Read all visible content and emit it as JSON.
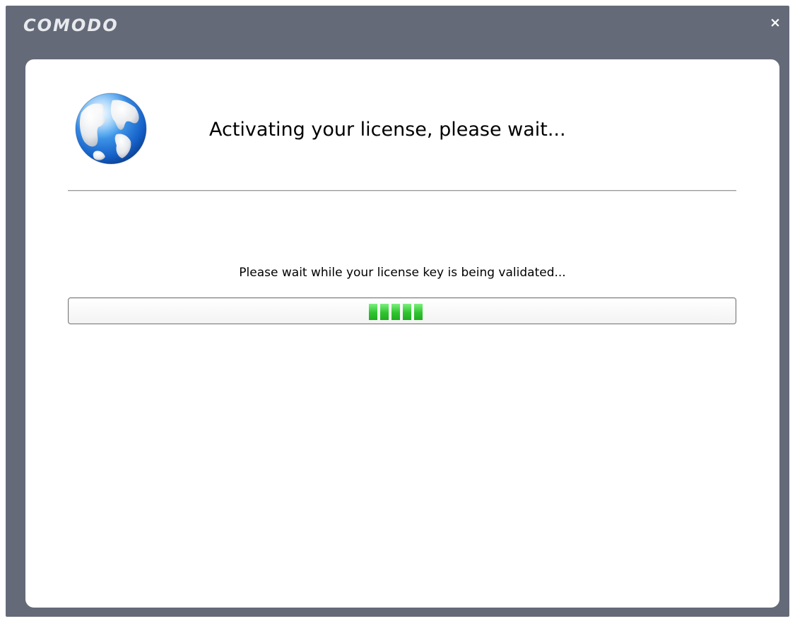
{
  "window": {
    "brand": "COMODO",
    "close_symbol": "×",
    "title_bar_color": "#646a78"
  },
  "content": {
    "icon": "globe-icon",
    "heading": "Activating your license, please wait...",
    "status_text": "Please wait while your license key is being validated...",
    "progress": {
      "style": "marquee",
      "position_fraction": 0.45,
      "chunk_count": 5,
      "chunk_color": "#2fc42f"
    }
  }
}
